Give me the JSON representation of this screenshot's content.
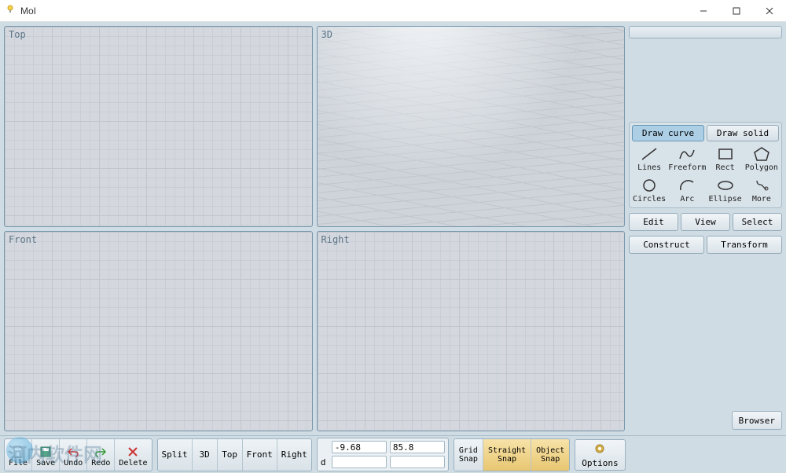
{
  "window": {
    "title": "MoI"
  },
  "viewports": {
    "top": "Top",
    "threeD": "3D",
    "front": "Front",
    "right": "Right"
  },
  "sidebar": {
    "tabs": {
      "draw_curve": "Draw curve",
      "draw_solid": "Draw solid"
    },
    "tools": {
      "lines": "Lines",
      "freeform": "Freeform",
      "rect": "Rect",
      "polygon": "Polygon",
      "circles": "Circles",
      "arc": "Arc",
      "ellipse": "Ellipse",
      "more": "More"
    },
    "buttons": {
      "edit": "Edit",
      "view": "View",
      "select": "Select",
      "construct": "Construct",
      "transform": "Transform"
    }
  },
  "bottombar": {
    "file": {
      "file": "File",
      "save": "Save",
      "undo": "Undo",
      "redo": "Redo",
      "delete": "Delete"
    },
    "views": {
      "split": "Split",
      "threeD": "3D",
      "top": "Top",
      "front": "Front",
      "right": "Right"
    },
    "coords": {
      "x": "-9.68",
      "y": "85.8",
      "d_label": "d",
      "d1": "",
      "d2": ""
    },
    "snap": {
      "grid": "Grid\nSnap",
      "straight": "Straight\nSnap",
      "object": "Object\nSnap"
    },
    "options": "Options",
    "browser": "Browser"
  },
  "watermark": "河内软件网"
}
